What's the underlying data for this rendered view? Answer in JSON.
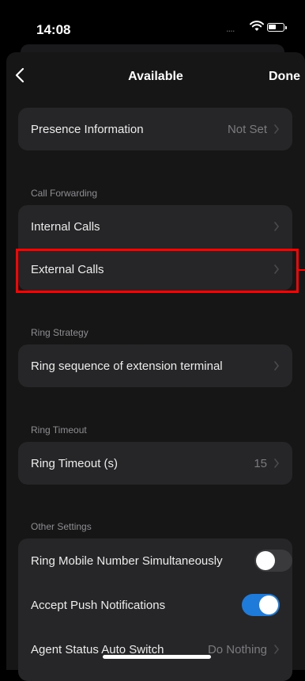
{
  "status_bar": {
    "time": "14:08",
    "signal": "....",
    "wifi_icon": "wifi-icon",
    "battery_icon": "battery-icon"
  },
  "nav": {
    "back_icon": "chevron-left-icon",
    "title": "Available",
    "done_label": "Done"
  },
  "presence": {
    "label": "Presence Information",
    "value": "Not Set"
  },
  "call_forwarding": {
    "header": "Call Forwarding",
    "items": [
      {
        "label": "Internal Calls"
      },
      {
        "label": "External Calls"
      }
    ]
  },
  "ring_strategy": {
    "header": "Ring Strategy",
    "item_label": "Ring sequence of extension terminal"
  },
  "ring_timeout": {
    "header": "Ring Timeout",
    "label": "Ring Timeout (s)",
    "value": "15"
  },
  "other_settings": {
    "header": "Other Settings",
    "ring_mobile": {
      "label": "Ring Mobile Number Simultaneously",
      "on": false
    },
    "push_notifications": {
      "label": "Accept Push Notifications",
      "on": true
    },
    "agent_status": {
      "label": "Agent Status Auto Switch",
      "value": "Do Nothing"
    }
  },
  "colors": {
    "background": "#000000",
    "sheet": "#161616",
    "card": "#262628",
    "accent": "#1f7bd9",
    "highlight": "#ff0000"
  }
}
